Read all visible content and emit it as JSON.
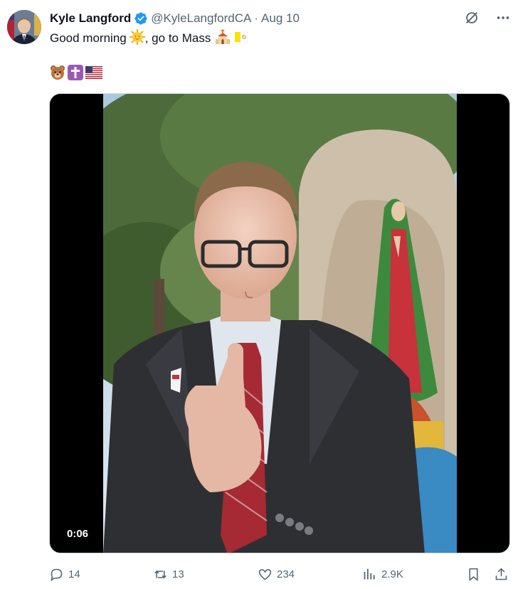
{
  "post": {
    "author_name": "Kyle Langford",
    "handle": "@KyleLangfordCA",
    "separator": "·",
    "date": "Aug 10",
    "text_part1": "Good morning",
    "text_part2": ", go to Mass",
    "emoji_line": [
      "bear-face",
      "latin-cross",
      "flag-us"
    ]
  },
  "media": {
    "type": "video",
    "timestamp": "0:06"
  },
  "actions": {
    "replies": "14",
    "reposts": "13",
    "likes": "234",
    "views": "2.9K"
  },
  "colors": {
    "text": "#0f1419",
    "secondary": "#536471",
    "verified": "#1d9bf0"
  }
}
